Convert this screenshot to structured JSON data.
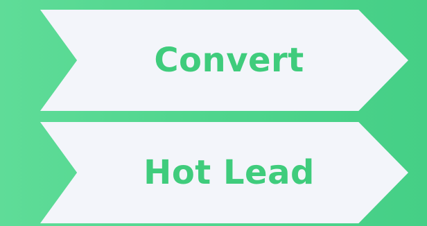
{
  "stages": [
    {
      "label": "Convert"
    },
    {
      "label": "Hot Lead"
    }
  ],
  "colors": {
    "background_start": "#5fdc98",
    "background_end": "#45cf86",
    "chevron_fill": "#f3f5fa",
    "label_text": "#3fcc7c"
  }
}
